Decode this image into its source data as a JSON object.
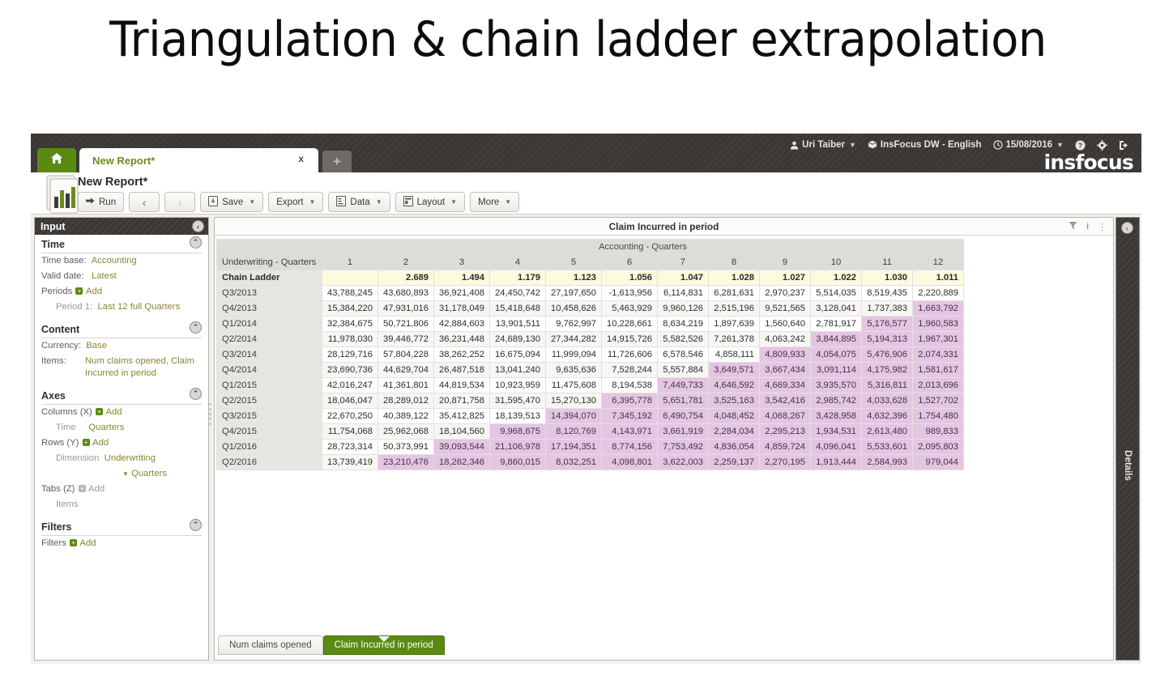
{
  "slide": {
    "title": "Triangulation & chain ladder extrapolation"
  },
  "topbar": {
    "user": "Uri Taiber",
    "workspace": "InsFocus DW - English",
    "date": "15/08/2016",
    "brand": "insfocus",
    "icons": {
      "user": "user-icon",
      "cube": "cube-icon",
      "clock": "clock-icon",
      "help": "help-icon",
      "settings": "gear-icon",
      "logout": "logout-icon"
    }
  },
  "tabs": {
    "home": "home-icon",
    "report_tab": "New Report*",
    "close": "x",
    "add": "+"
  },
  "toolbar": {
    "report_title": "New Report*",
    "run": "Run",
    "back": "‹",
    "forward": "›",
    "save": "Save",
    "export": "Export",
    "data": "Data",
    "layout": "Layout",
    "more": "More"
  },
  "input_panel": {
    "header": "Input",
    "collapse_icon": "‹",
    "time": {
      "title": "Time",
      "time_base_label": "Time base:",
      "time_base_value": "Accounting",
      "valid_date_label": "Valid date:",
      "valid_date_value": "Latest",
      "periods_label": "Periods",
      "periods_add": "Add",
      "period1_label": "Period 1:",
      "period1_value": "Last 12 full Quarters"
    },
    "content": {
      "title": "Content",
      "currency_label": "Currency:",
      "currency_value": "Base",
      "items_label": "Items:",
      "items_value": "Num claims opened, Claim Incurred in period"
    },
    "axes": {
      "title": "Axes",
      "columns_label": "Columns (X)",
      "columns_add": "Add",
      "columns_type": "Time",
      "columns_value": "Quarters",
      "rows_label": "Rows (Y)",
      "rows_add": "Add",
      "rows_type": "Dimension",
      "rows_value": "Underwriting",
      "rows_sub": "Quarters",
      "tabs_label": "Tabs (Z)",
      "tabs_add": "Add",
      "tabs_value": "Items"
    },
    "filters": {
      "title": "Filters",
      "filters_label": "Filters",
      "filters_add": "Add"
    }
  },
  "canvas": {
    "title": "Claim Incurred in period",
    "icons": [
      "filter-icon",
      "info-icon",
      "kebab-menu-icon"
    ]
  },
  "details_panel": {
    "label": "Details",
    "collapse_icon": "‹"
  },
  "bottom_tabs": [
    {
      "label": "Num claims opened",
      "active": false
    },
    {
      "label": "Claim Incurred in period",
      "active": true
    }
  ],
  "chart_data": {
    "type": "table",
    "title": "Claim Incurred in period",
    "column_group_header": "Accounting - Quarters",
    "row_header": "Underwriting - Quarters",
    "categories": [
      "1",
      "2",
      "3",
      "4",
      "5",
      "6",
      "7",
      "8",
      "9",
      "10",
      "11",
      "12"
    ],
    "chain_ladder_label": "Chain Ladder",
    "chain_ladder": [
      "",
      "2.689",
      "1.494",
      "1.179",
      "1.123",
      "1.056",
      "1.047",
      "1.028",
      "1.027",
      "1.022",
      "1.030",
      "1.011"
    ],
    "rows": [
      {
        "label": "Q3/2013",
        "values": [
          "43,788,245",
          "43,680,893",
          "36,921,408",
          "24,450,742",
          "27,197,650",
          "-1,613,956",
          "6,114,831",
          "6,281,631",
          "2,970,237",
          "5,514,035",
          "8,519,435",
          "2,220,889"
        ],
        "highlight_from": 13
      },
      {
        "label": "Q4/2013",
        "values": [
          "15,384,220",
          "47,931,016",
          "31,178,049",
          "15,418,648",
          "10,458,626",
          "5,463,929",
          "9,960,126",
          "2,515,196",
          "9,521,565",
          "3,128,041",
          "1,737,383",
          "1,663,792"
        ],
        "highlight_from": 12
      },
      {
        "label": "Q1/2014",
        "values": [
          "32,384,675",
          "50,721,806",
          "42,884,603",
          "13,901,511",
          "9,762,997",
          "10,228,661",
          "8,634,219",
          "1,897,639",
          "1,560,640",
          "2,781,917",
          "5,176,577",
          "1,960,583"
        ],
        "highlight_from": 11
      },
      {
        "label": "Q2/2014",
        "values": [
          "11,978,030",
          "39,446,772",
          "36,231,448",
          "24,689,130",
          "27,344,282",
          "14,915,726",
          "5,582,526",
          "7,261,378",
          "4,063,242",
          "3,844,895",
          "5,194,313",
          "1,967,301"
        ],
        "highlight_from": 10
      },
      {
        "label": "Q3/2014",
        "values": [
          "28,129,716",
          "57,804,228",
          "38,262,252",
          "16,675,094",
          "11,999,094",
          "11,726,606",
          "6,578,546",
          "4,858,111",
          "4,809,933",
          "4,054,075",
          "5,476,906",
          "2,074,331"
        ],
        "highlight_from": 9
      },
      {
        "label": "Q4/2014",
        "values": [
          "23,690,736",
          "44,629,704",
          "26,487,518",
          "13,041,240",
          "9,635,636",
          "7,528,244",
          "5,557,884",
          "3,649,571",
          "3,667,434",
          "3,091,114",
          "4,175,982",
          "1,581,617"
        ],
        "highlight_from": 8
      },
      {
        "label": "Q1/2015",
        "values": [
          "42,016,247",
          "41,361,801",
          "44,819,534",
          "10,923,959",
          "11,475,608",
          "8,194,538",
          "7,449,733",
          "4,646,592",
          "4,669,334",
          "3,935,570",
          "5,316,811",
          "2,013,696"
        ],
        "highlight_from": 7
      },
      {
        "label": "Q2/2015",
        "values": [
          "18,046,047",
          "28,289,012",
          "20,871,758",
          "31,595,470",
          "15,270,130",
          "6,395,778",
          "5,651,781",
          "3,525,163",
          "3,542,416",
          "2,985,742",
          "4,033,628",
          "1,527,702"
        ],
        "highlight_from": 6
      },
      {
        "label": "Q3/2015",
        "values": [
          "22,670,250",
          "40,389,122",
          "35,412,825",
          "18,139,513",
          "14,394,070",
          "7,345,192",
          "6,490,754",
          "4,048,452",
          "4,068,267",
          "3,428,958",
          "4,632,396",
          "1,754,480"
        ],
        "highlight_from": 5
      },
      {
        "label": "Q4/2015",
        "values": [
          "11,754,068",
          "25,962,068",
          "18,104,560",
          "9,968,675",
          "8,120,769",
          "4,143,971",
          "3,661,919",
          "2,284,034",
          "2,295,213",
          "1,934,531",
          "2,613,480",
          "989,833"
        ],
        "highlight_from": 4
      },
      {
        "label": "Q1/2016",
        "values": [
          "28,723,314",
          "50,373,991",
          "39,093,544",
          "21,106,978",
          "17,194,351",
          "8,774,156",
          "7,753,492",
          "4,836,054",
          "4,859,724",
          "4,096,041",
          "5,533,601",
          "2,095,803"
        ],
        "highlight_from": 3
      },
      {
        "label": "Q2/2016",
        "values": [
          "13,739,419",
          "23,210,476",
          "18,262,346",
          "9,860,015",
          "8,032,251",
          "4,098,801",
          "3,622,003",
          "2,259,137",
          "2,270,195",
          "1,913,444",
          "2,584,993",
          "979,044"
        ],
        "highlight_from": 2
      }
    ],
    "colors": {
      "highlight": "#e4c6e3",
      "chain_ladder_bg": "#fbfbdf",
      "accent": "#5b8a12"
    }
  }
}
